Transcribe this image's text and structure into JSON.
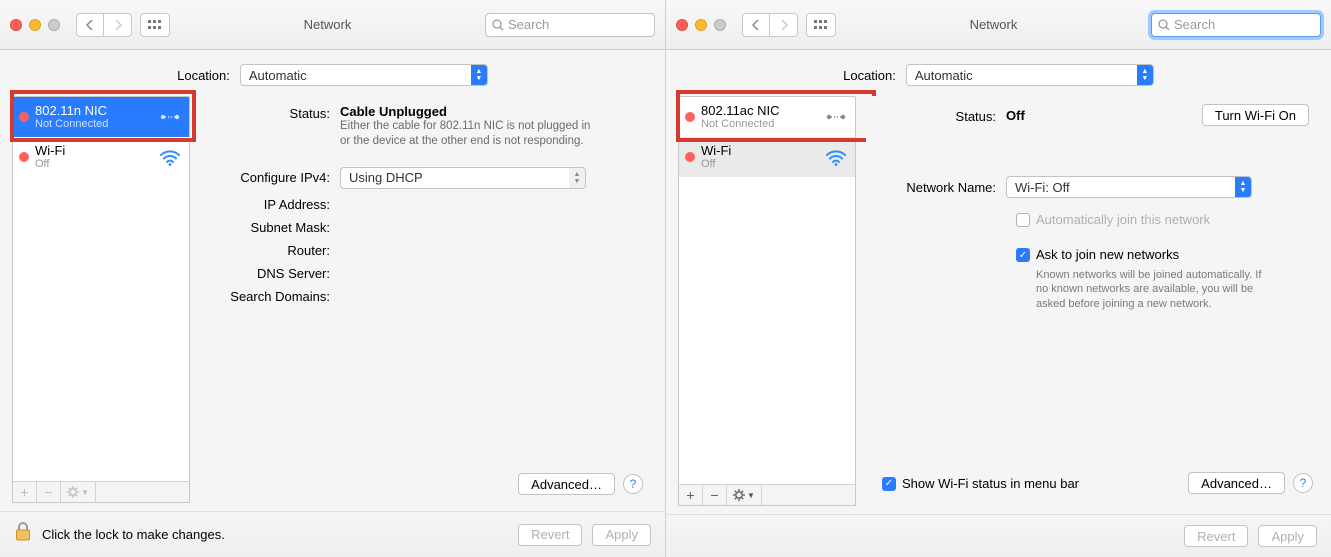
{
  "common": {
    "window_title": "Network",
    "search_placeholder": "Search",
    "location_label": "Location:",
    "location_value": "Automatic",
    "advanced_btn": "Advanced…",
    "revert_btn": "Revert",
    "apply_btn": "Apply",
    "help": "?"
  },
  "left": {
    "sidebar": [
      {
        "name": "802.11n NIC",
        "sub": "Not Connected",
        "kind": "ethernet",
        "selected": true
      },
      {
        "name": "Wi-Fi",
        "sub": "Off",
        "kind": "wifi",
        "selected": false
      }
    ],
    "status_label": "Status:",
    "status_value": "Cable Unplugged",
    "status_sub": "Either the cable for 802.11n NIC is not plugged in or the device at the other end is not responding.",
    "config_label": "Configure IPv4:",
    "config_value": "Using DHCP",
    "ip_label": "IP Address:",
    "subnet_label": "Subnet Mask:",
    "router_label": "Router:",
    "dns_label": "DNS Server:",
    "search_domains_label": "Search Domains:",
    "lock_text": "Click the lock to make changes."
  },
  "right": {
    "sidebar": [
      {
        "name": "802.11ac NIC",
        "sub": "Not Connected",
        "kind": "ethernet",
        "selected": false
      },
      {
        "name": "Wi-Fi",
        "sub": "Off",
        "kind": "wifi",
        "selected": true
      }
    ],
    "status_label": "Status:",
    "status_value": "Off",
    "turn_on_btn": "Turn Wi-Fi On",
    "network_name_label": "Network Name:",
    "network_name_value": "Wi-Fi: Off",
    "auto_join_label": "Automatically join this network",
    "ask_join_label": "Ask to join new networks",
    "ask_join_sub": "Known networks will be joined automatically. If no known networks are available, you will be asked before joining a new network.",
    "show_status_label": "Show Wi-Fi status in menu bar"
  }
}
